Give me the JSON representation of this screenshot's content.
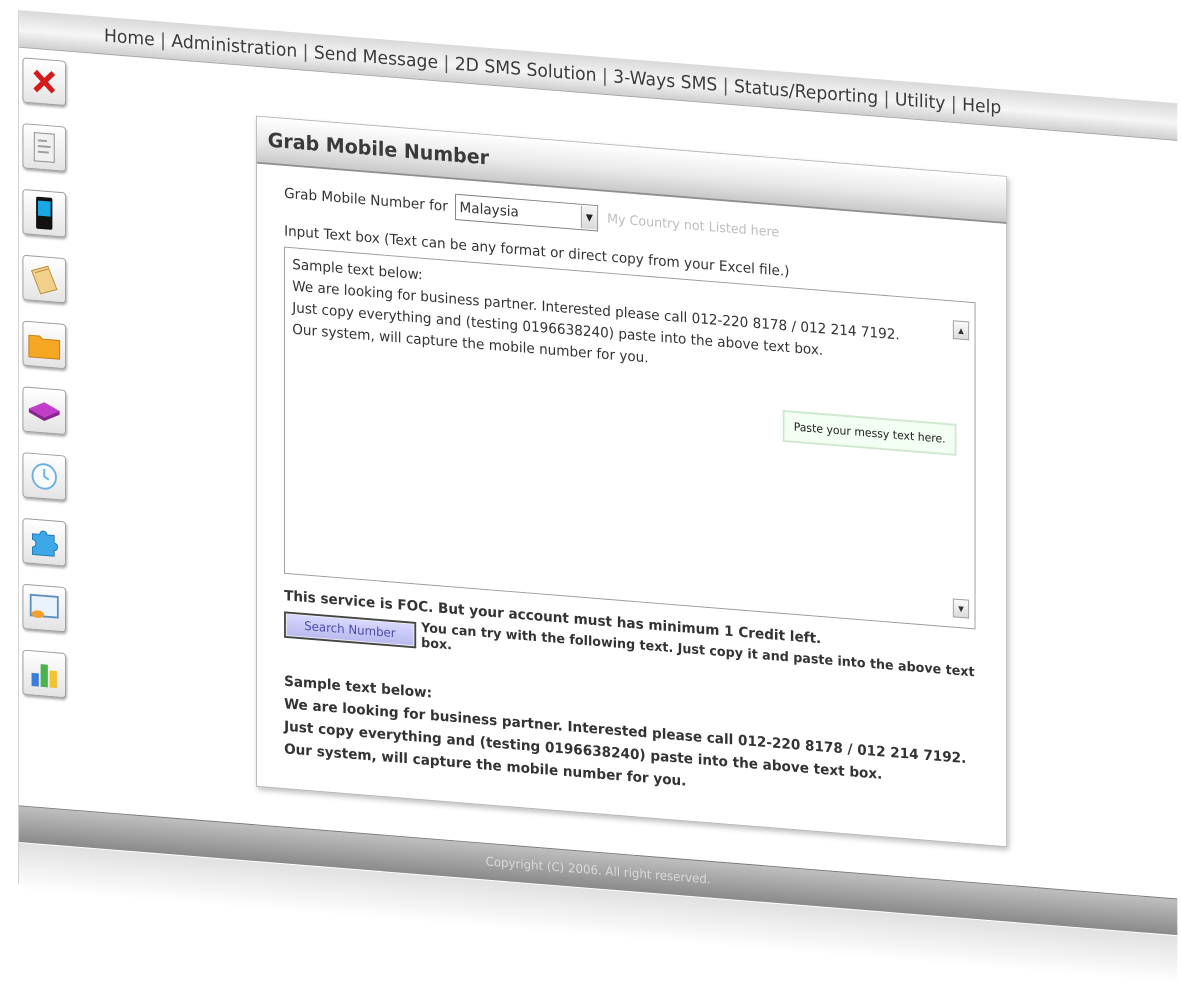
{
  "nav": {
    "items": [
      "Home",
      "Administration",
      "Send Message",
      "2D SMS Solution",
      "3-Ways SMS",
      "Status/Reporting",
      "Utility",
      "Help"
    ],
    "separator": "|"
  },
  "sidebar": {
    "icons": [
      "close-icon",
      "document-icon",
      "mobile-phone-icon",
      "notepad-icon",
      "folder-icon",
      "book-icon",
      "clock-icon",
      "puzzle-icon",
      "monitor-icon",
      "bar-chart-icon"
    ]
  },
  "panel": {
    "title": "Grab Mobile Number",
    "country_label": "Grab Mobile Number for",
    "country_selected": "Malaysia",
    "country_link": "My Country not Listed here",
    "input_label": "Input Text box (Text can be any format or direct copy from your Excel file.)",
    "textbox_lines": [
      "Sample text below:",
      "We are looking for business partner. Interested please call 012-220 8178 / 012 214 7192.",
      "Just copy everything and (testing 0196638240) paste into the above text box.",
      "Our system, will capture the mobile number for you."
    ],
    "tooltip": "Paste your messy text here.",
    "foc_notice": "This service is FOC. But your account must has minimum 1 Credit left.",
    "search_button": "Search Number",
    "search_hint": "You can try with the following text. Just copy it and paste into the above text box.",
    "sample_lines": [
      "Sample text below:",
      "We are looking for business partner. Interested please call 012-220 8178 / 012 214 7192.",
      "Just copy everything and (testing 0196638240) paste into the above text box.",
      "Our system, will capture the mobile number for you."
    ]
  },
  "footer": {
    "line1": "Copyright (C) 2006. All right reserved."
  },
  "colors": {
    "accent_red": "#9c1d1d",
    "footer_bg": "#8a8a8a",
    "button_bg": "#c9c9f5"
  }
}
